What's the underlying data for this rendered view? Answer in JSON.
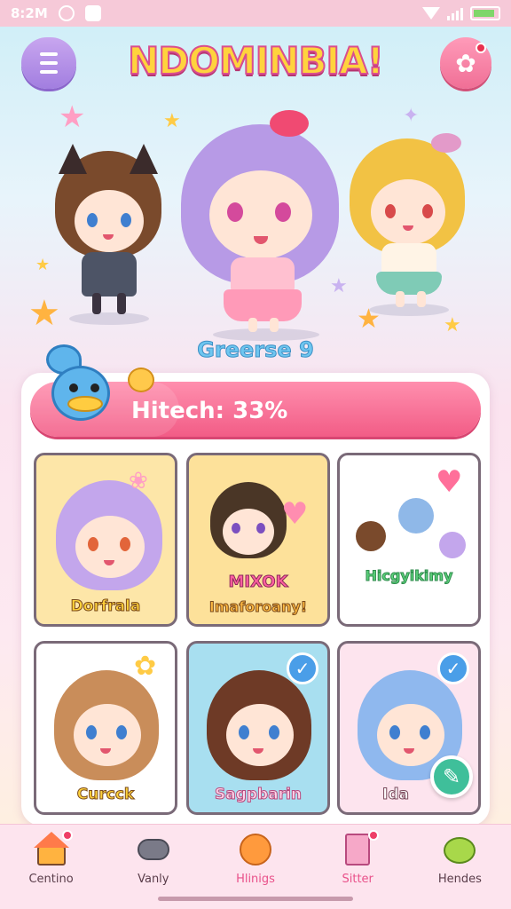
{
  "status_bar": {
    "time": "8:2M",
    "battery_fill": 0.9
  },
  "header": {
    "title": "NDOMINBIA!",
    "menu_icon": "hamburger-icon",
    "settings_icon": "gear-icon"
  },
  "hero": {
    "label": "Greerse 9"
  },
  "progress": {
    "label": "Hitech: 33%",
    "value": 0.33
  },
  "cards": [
    {
      "label": "Dorfrala",
      "sub": ""
    },
    {
      "label": "MIXOK",
      "sub": "Imaforoany!"
    },
    {
      "label": "",
      "sub": "Hicgyikimy"
    },
    {
      "label": "Curcck",
      "sub": ""
    },
    {
      "label": "Sagpbarin",
      "sub": ""
    },
    {
      "label": "Ida",
      "sub": ""
    }
  ],
  "nav": [
    {
      "label": "Centino",
      "icon": "home-icon"
    },
    {
      "label": "Vanly",
      "icon": "gamepad-icon"
    },
    {
      "label": "Hlinigs",
      "icon": "smiley-icon"
    },
    {
      "label": "Sitter",
      "icon": "list-icon"
    },
    {
      "label": "Hendes",
      "icon": "frog-icon"
    }
  ],
  "colors": {
    "accent_pink": "#f25c86",
    "accent_purple": "#a27ee0",
    "accent_blue": "#4a9ee8"
  }
}
